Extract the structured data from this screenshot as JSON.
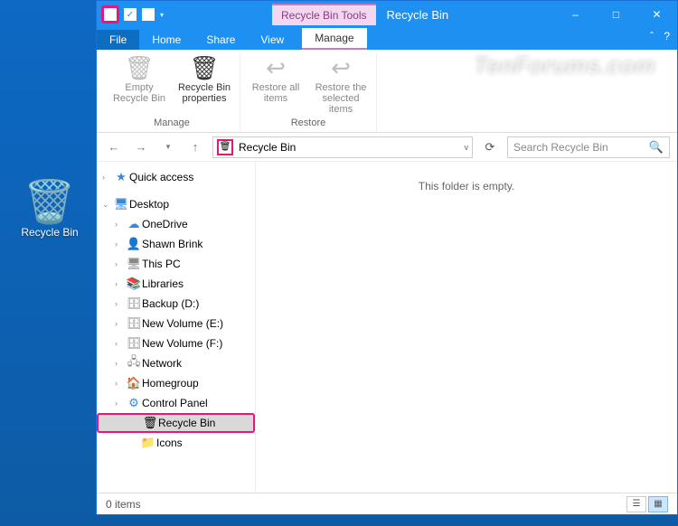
{
  "desktop": {
    "recycle_bin_label": "Recycle Bin"
  },
  "titlebar": {
    "context_title": "Recycle Bin Tools",
    "window_title": "Recycle Bin"
  },
  "tabs": {
    "file": "File",
    "home": "Home",
    "share": "Share",
    "view": "View",
    "manage": "Manage"
  },
  "ribbon": {
    "manage": {
      "empty": "Empty Recycle Bin",
      "props": "Recycle Bin properties",
      "group_label": "Manage"
    },
    "restore": {
      "all": "Restore all items",
      "selected": "Restore the selected items",
      "group_label": "Restore"
    }
  },
  "address": {
    "location": "Recycle Bin",
    "search_placeholder": "Search Recycle Bin"
  },
  "tree": {
    "quick_access": "Quick access",
    "desktop": "Desktop",
    "items": [
      {
        "icon": "☁",
        "label": "OneDrive",
        "cls": "ic-blue"
      },
      {
        "icon": "👤",
        "label": "Shawn Brink",
        "cls": "ic-gray"
      },
      {
        "icon": "🖥",
        "label": "This PC",
        "cls": "ic-gray"
      },
      {
        "icon": "📚",
        "label": "Libraries",
        "cls": "ic-yellow"
      },
      {
        "icon": "🗄",
        "label": "Backup (D:)",
        "cls": "ic-gray"
      },
      {
        "icon": "🗄",
        "label": "New Volume (E:)",
        "cls": "ic-gray"
      },
      {
        "icon": "🗄",
        "label": "New Volume (F:)",
        "cls": "ic-gray"
      },
      {
        "icon": "🖧",
        "label": "Network",
        "cls": "ic-gray"
      },
      {
        "icon": "🏠",
        "label": "Homegroup",
        "cls": "ic-green"
      },
      {
        "icon": "⚙",
        "label": "Control Panel",
        "cls": "ic-blue"
      }
    ],
    "recycle_bin": "Recycle Bin",
    "icons": "Icons"
  },
  "content": {
    "empty_msg": "This folder is empty."
  },
  "status": {
    "count": "0 items"
  },
  "watermark": "TenForums.com"
}
